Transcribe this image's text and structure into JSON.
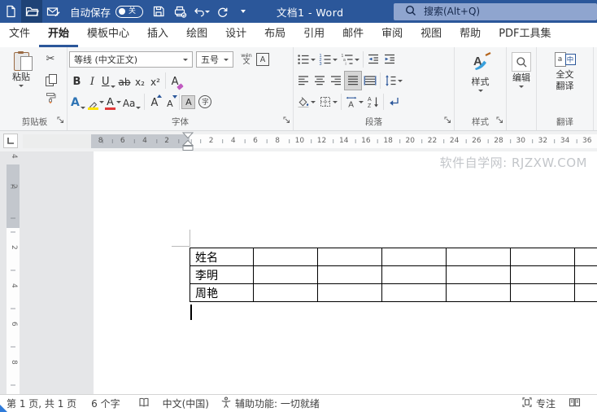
{
  "titlebar": {
    "autosave_label": "自动保存",
    "autosave_state": "关",
    "doc_title": "文档1  -  Word",
    "search_placeholder": "搜索(Alt+Q)"
  },
  "tabs": {
    "items": [
      "文件",
      "开始",
      "模板中心",
      "插入",
      "绘图",
      "设计",
      "布局",
      "引用",
      "邮件",
      "审阅",
      "视图",
      "帮助",
      "PDF工具集"
    ],
    "active": "开始"
  },
  "ribbon": {
    "clipboard": {
      "paste_label": "粘贴",
      "group_label": "剪贴板"
    },
    "font": {
      "name_value": "等线 (中文正文)",
      "size_value": "五号",
      "group_label": "字体",
      "glyphs": {
        "bold": "B",
        "italic": "I",
        "underline": "U",
        "strikethrough": "ab",
        "subscript": "x₂",
        "superscript": "x²",
        "clear": "A",
        "text_effects": "A",
        "font_color": "A",
        "change_case": "Aa",
        "grow": "A",
        "shrink": "A",
        "char_shading": "A",
        "enclose": "字",
        "phonetic_top": "wén",
        "phonetic_bottom": "文",
        "char_border": "A"
      }
    },
    "paragraph": {
      "group_label": "段落"
    },
    "styles": {
      "button_label": "样式",
      "group_label": "样式",
      "glyph": "A"
    },
    "editing": {
      "button_label": "编辑"
    },
    "translate": {
      "button_line1": "全文",
      "button_line2": "翻译",
      "group_label": "翻译",
      "glyph_a": "a",
      "glyph_zh": "中"
    }
  },
  "ruler": {
    "h_left": [
      "8",
      "6",
      "4",
      "2"
    ],
    "h_right": [
      "2",
      "4",
      "6",
      "8",
      "10",
      "12",
      "14",
      "16",
      "18",
      "20",
      "22",
      "24",
      "26",
      "28",
      "30",
      "32",
      "34",
      "36"
    ],
    "v_top": [
      "4",
      "2"
    ],
    "v_bottom": [
      "2",
      "4",
      "6",
      "8"
    ]
  },
  "document": {
    "watermark": "软件自学网: RJZXW.COM",
    "table": {
      "rows": [
        [
          "姓名",
          "",
          "",
          "",
          "",
          "",
          ""
        ],
        [
          "李明",
          "",
          "",
          "",
          "",
          "",
          ""
        ],
        [
          "周艳",
          "",
          "",
          "",
          "",
          "",
          ""
        ]
      ]
    }
  },
  "statusbar": {
    "page_info": "第 1 页, 共 1 页",
    "word_count": "6 个字",
    "language": "中文(中国)",
    "accessibility": "辅助功能: 一切就绪",
    "focus_label": "专注"
  },
  "colors": {
    "titlebar": "#2b579a",
    "accent": "#2b579a",
    "highlight_yellow": "#ffe400",
    "font_color_red": "#e03a3a"
  }
}
